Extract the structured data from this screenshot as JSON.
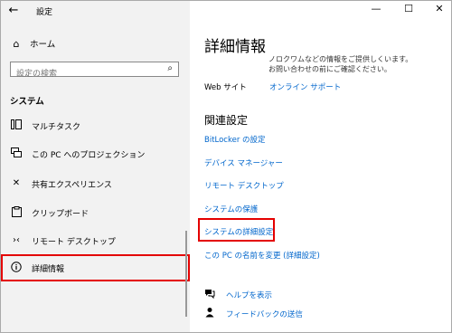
{
  "titlebar": {
    "title": "設定",
    "back_icon": "←"
  },
  "window_controls": [
    "—",
    "☐",
    "✕"
  ],
  "sidebar": {
    "home_label": "ホーム",
    "search_placeholder": "設定の検索",
    "section_title": "システム",
    "items": [
      {
        "label": "マルチタスク",
        "icon": "multitask-icon"
      },
      {
        "label": "この PC へのプロジェクション",
        "icon": "projection-icon"
      },
      {
        "label": "共有エクスペリエンス",
        "icon": "shared-experience-icon"
      },
      {
        "label": "クリップボード",
        "icon": "clipboard-icon"
      },
      {
        "label": "リモート デスクトップ",
        "icon": "remote-desktop-icon"
      },
      {
        "label": "詳細情報",
        "icon": "info-icon"
      }
    ]
  },
  "main": {
    "heading": "詳細情報",
    "description_line1": "ノロクワムなどの情報をご提供しくいます。",
    "description_line2": "お問い合わせの前にご確認ください。",
    "web_label": "Web サイト",
    "web_link": "オンライン サポート",
    "related_heading": "関連設定",
    "related_links": [
      "BitLocker の設定",
      "デバイス マネージャー",
      "リモート デスクトップ",
      "システムの保護",
      "システムの詳細設定",
      "この PC の名前を変更 (詳細設定)"
    ],
    "help_links": [
      "ヘルプを表示",
      "フィードバックの送信"
    ]
  },
  "colors": {
    "highlight": "#e40000",
    "link": "#0066cc",
    "sidebar_bg": "#f2f2f2"
  }
}
